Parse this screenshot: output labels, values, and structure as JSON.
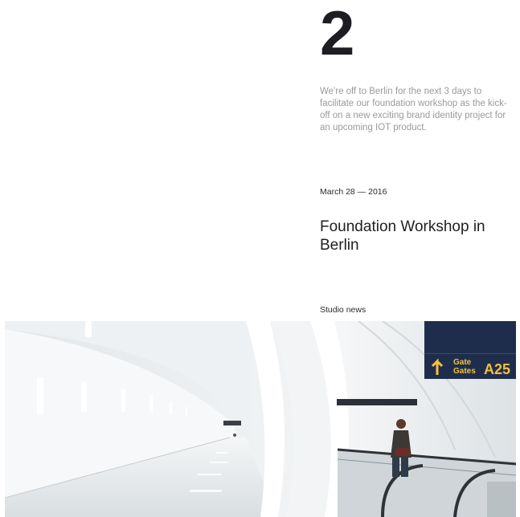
{
  "post": {
    "number": "2",
    "excerpt": "We're off to Berlin for the next 3 days to facilitate our foundation workshop as the kick-off on a new exciting brand identity project for an upcoming IOT product.",
    "date": "March 28 — 2016",
    "title": "Foundation Workshop in Berlin",
    "category": "Studio news"
  },
  "hero_image": {
    "sign": {
      "line1": "Gate",
      "line2": "Gates",
      "code": "A25",
      "icon": "arrow-up-icon"
    },
    "colors": {
      "sign_bg": "#1f2d4d",
      "sign_text": "#f2c23a"
    }
  }
}
